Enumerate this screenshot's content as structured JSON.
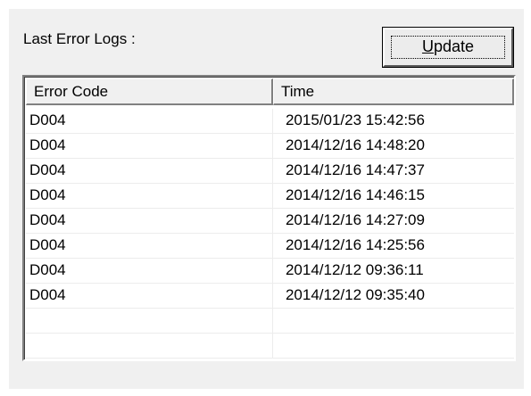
{
  "panel": {
    "title": "Last Error Logs :"
  },
  "toolbar": {
    "update_mnemonic": "U",
    "update_rest": "pdate"
  },
  "table": {
    "columns": [
      "Error Code",
      "Time"
    ],
    "rows": [
      {
        "code": "D004",
        "time": "2015/01/23 15:42:56"
      },
      {
        "code": "D004",
        "time": "2014/12/16 14:48:20"
      },
      {
        "code": "D004",
        "time": "2014/12/16 14:47:37"
      },
      {
        "code": "D004",
        "time": "2014/12/16 14:46:15"
      },
      {
        "code": "D004",
        "time": "2014/12/16 14:27:09"
      },
      {
        "code": "D004",
        "time": "2014/12/16 14:25:56"
      },
      {
        "code": "D004",
        "time": "2014/12/12 09:36:11"
      },
      {
        "code": "D004",
        "time": "2014/12/12 09:35:40"
      },
      {
        "code": "",
        "time": ""
      },
      {
        "code": "",
        "time": ""
      }
    ]
  }
}
